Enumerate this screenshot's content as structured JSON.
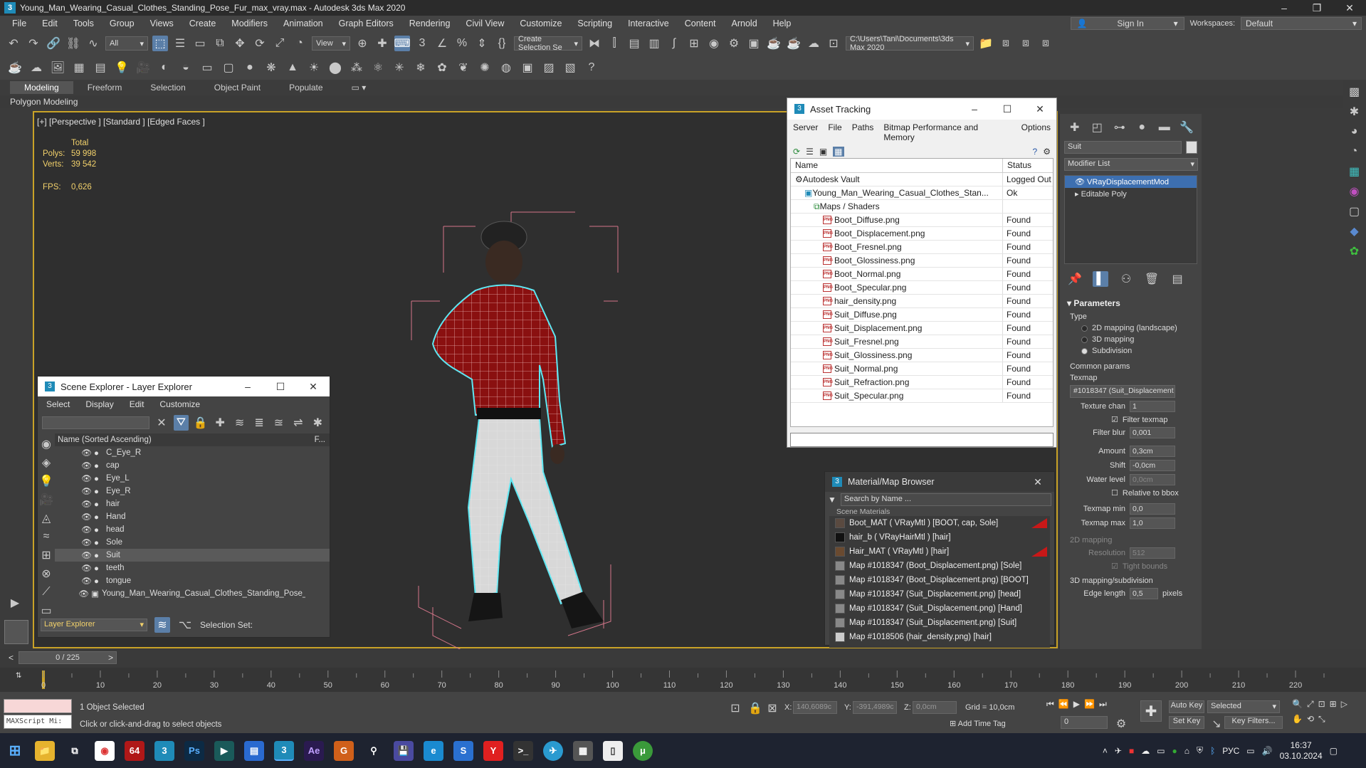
{
  "window": {
    "title": "Young_Man_Wearing_Casual_Clothes_Standing_Pose_Fur_max_vray.max - Autodesk 3ds Max 2020",
    "app_icon_text": "3"
  },
  "menu": [
    "File",
    "Edit",
    "Tools",
    "Group",
    "Views",
    "Create",
    "Modifiers",
    "Animation",
    "Graph Editors",
    "Rendering",
    "Civil View",
    "Customize",
    "Scripting",
    "Interactive",
    "Content",
    "Arnold",
    "Help"
  ],
  "signin_label": "Sign In",
  "workspaces_label": "Workspaces:",
  "workspace_value": "Default",
  "toolbar": {
    "filter": "All",
    "refcoord": "View",
    "selection_set": "Create Selection Se",
    "path": "C:\\Users\\Tani\\Documents\\3ds Max 2020"
  },
  "ribbon": {
    "tabs": [
      "Modeling",
      "Freeform",
      "Selection",
      "Object Paint",
      "Populate"
    ],
    "sub": "Polygon Modeling"
  },
  "viewport": {
    "label": "[+] [Perspective ] [Standard ] [Edged Faces ]",
    "total_label": "Total",
    "polys_label": "Polys:",
    "polys": "59 998",
    "verts_label": "Verts:",
    "verts": "39 542",
    "fps_label": "FPS:",
    "fps": "0,626"
  },
  "asset_tracking": {
    "title": "Asset Tracking",
    "menu": [
      "Server",
      "File",
      "Paths",
      "Bitmap Performance and Memory",
      "Options"
    ],
    "col_name": "Name",
    "col_status": "Status",
    "rows": [
      {
        "name": "Autodesk Vault",
        "status": "Logged Out",
        "indent": 1
      },
      {
        "name": "Young_Man_Wearing_Casual_Clothes_Stan...",
        "status": "Ok",
        "indent": 2
      },
      {
        "name": "Maps / Shaders",
        "status": "",
        "indent": 3
      },
      {
        "name": "Boot_Diffuse.png",
        "status": "Found",
        "indent": 4
      },
      {
        "name": "Boot_Displacement.png",
        "status": "Found",
        "indent": 4
      },
      {
        "name": "Boot_Fresnel.png",
        "status": "Found",
        "indent": 4
      },
      {
        "name": "Boot_Glossiness.png",
        "status": "Found",
        "indent": 4
      },
      {
        "name": "Boot_Normal.png",
        "status": "Found",
        "indent": 4
      },
      {
        "name": "Boot_Specular.png",
        "status": "Found",
        "indent": 4
      },
      {
        "name": "hair_density.png",
        "status": "Found",
        "indent": 4
      },
      {
        "name": "Suit_Diffuse.png",
        "status": "Found",
        "indent": 4
      },
      {
        "name": "Suit_Displacement.png",
        "status": "Found",
        "indent": 4
      },
      {
        "name": "Suit_Fresnel.png",
        "status": "Found",
        "indent": 4
      },
      {
        "name": "Suit_Glossiness.png",
        "status": "Found",
        "indent": 4
      },
      {
        "name": "Suit_Normal.png",
        "status": "Found",
        "indent": 4
      },
      {
        "name": "Suit_Refraction.png",
        "status": "Found",
        "indent": 4
      },
      {
        "name": "Suit_Specular.png",
        "status": "Found",
        "indent": 4
      }
    ]
  },
  "scene_explorer": {
    "title": "Scene Explorer - Layer Explorer",
    "menu": [
      "Select",
      "Display",
      "Edit",
      "Customize"
    ],
    "col_name": "Name (Sorted Ascending)",
    "col_f": "F...",
    "items": [
      "C_Eye_R",
      "cap",
      "Eye_L",
      "Eye_R",
      "hair",
      "Hand",
      "head",
      "Sole",
      "Suit",
      "teeth",
      "tongue",
      "Young_Man_Wearing_Casual_Clothes_Standing_Pose_Fur"
    ],
    "selected": "Suit",
    "footer_explorer": "Layer Explorer",
    "footer_selset": "Selection Set:"
  },
  "material_browser": {
    "title": "Material/Map Browser",
    "search_placeholder": "Search by Name ...",
    "section": "Scene Materials",
    "items": [
      {
        "label": "Boot_MAT ( VRayMtl ) [BOOT, cap, Sole]",
        "color": "#5a4a40",
        "flag": true
      },
      {
        "label": "hair_b ( VRayHairMtl ) [hair]",
        "color": "#111111",
        "flag": false
      },
      {
        "label": "Hair_MAT ( VRayMtl ) [hair]",
        "color": "#6a4a30",
        "flag": true
      },
      {
        "label": "Map #1018347 (Boot_Displacement.png) [Sole]",
        "color": "#888888",
        "flag": false
      },
      {
        "label": "Map #1018347 (Boot_Displacement.png) [BOOT]",
        "color": "#888888",
        "flag": false
      },
      {
        "label": "Map #1018347 (Suit_Displacement.png) [head]",
        "color": "#888888",
        "flag": false
      },
      {
        "label": "Map #1018347 (Suit_Displacement.png) [Hand]",
        "color": "#888888",
        "flag": false
      },
      {
        "label": "Map #1018347 (Suit_Displacement.png) [Suit]",
        "color": "#888888",
        "flag": false
      },
      {
        "label": "Map #1018506 (hair_density.png) [hair]",
        "color": "#cccccc",
        "flag": false
      }
    ]
  },
  "command_panel": {
    "object_name": "Suit",
    "modifier_list": "Modifier List",
    "modifiers": [
      "VRayDisplacementMod",
      "Editable Poly"
    ],
    "parameters_title": "Parameters",
    "type_label": "Type",
    "types": [
      "2D mapping (landscape)",
      "3D mapping",
      "Subdivision"
    ],
    "selected_type": "Subdivision",
    "common_params": "Common params",
    "texmap_label": "Texmap",
    "texmap_value": "#1018347 (Suit_Displacement",
    "texture_chan_label": "Texture chan",
    "texture_chan": "1",
    "filter_texmap": "Filter texmap",
    "filter_blur_label": "Filter blur",
    "filter_blur": "0,001",
    "amount_label": "Amount",
    "amount": "0,3cm",
    "shift_label": "Shift",
    "shift": "-0,0cm",
    "water_level_label": "Water level",
    "water_level": "0,0cm",
    "relative_bbox": "Relative to bbox",
    "texmap_min_label": "Texmap min",
    "texmap_min": "0,0",
    "texmap_max_label": "Texmap max",
    "texmap_max": "1,0",
    "mapping_2d": "2D mapping",
    "resolution_label": "Resolution",
    "resolution": "512",
    "tight_bounds": "Tight bounds",
    "mapping_3d": "3D mapping/subdivision",
    "edge_length_label": "Edge length",
    "edge_length": "0,5",
    "edge_unit": "pixels"
  },
  "timeline": {
    "frame": "0 / 225",
    "ticks": [
      "0",
      "10",
      "20",
      "30",
      "40",
      "50",
      "60",
      "70",
      "80",
      "90",
      "100",
      "110",
      "120",
      "130",
      "140",
      "150",
      "160",
      "170",
      "180",
      "190",
      "200",
      "210",
      "220"
    ]
  },
  "status": {
    "maxscript": "MAXScript Mi:",
    "selected": "1 Object Selected",
    "hint": "Click or click-and-drag to select objects",
    "x_label": "X:",
    "x": "140,6089c",
    "y_label": "Y:",
    "y": "-391,4989c",
    "z_label": "Z:",
    "z": "0,0cm",
    "grid": "Grid = 10,0cm",
    "add_time_tag": "Add Time Tag",
    "auto_key": "Auto Key",
    "set_key": "Set Key",
    "selected_dd": "Selected",
    "key_filters": "Key Filters...",
    "frame_field": "0"
  },
  "taskbar": {
    "lang": "РУС",
    "time": "16:37",
    "date": "03.10.2024"
  }
}
